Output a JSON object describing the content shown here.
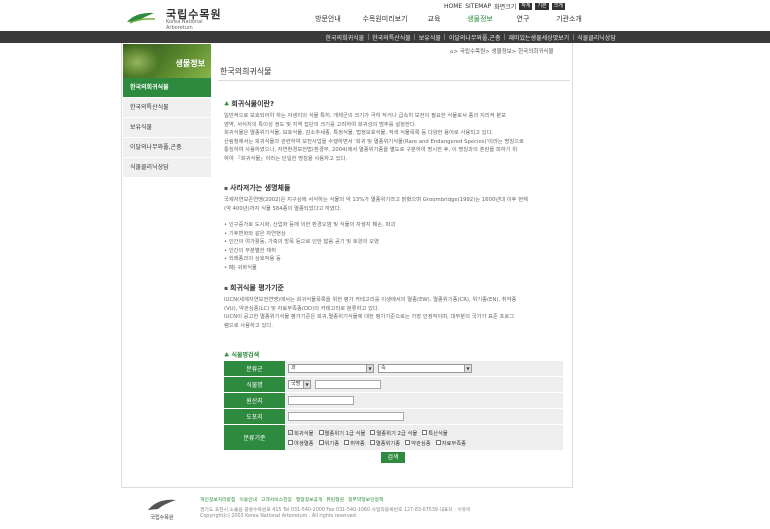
{
  "brand": {
    "name_ko": "국립수목원",
    "name_en": "Korea National Arboretum"
  },
  "util": {
    "home": "HOME",
    "sitemap": "SITEMAP",
    "font_size_label": "화면크기",
    "font_small": "작게",
    "font_normal": "기본",
    "font_large": "크게"
  },
  "gnb": [
    "방문안내",
    "수목원미리보기",
    "교육",
    "생물정보",
    "연구",
    "기관소개"
  ],
  "subnav": [
    "한국의희귀식물",
    "한국의특산식물",
    "보유식물",
    "이달의나무와풀,곤충",
    "재미있는생물세상엿보기",
    "식물클리닉상담"
  ],
  "side": {
    "title": "생물정보",
    "items": [
      "한국의희귀식물",
      "한국의특산식물",
      "보유식물",
      "이달의나무와풀,곤충",
      "식물클리닉상담"
    ]
  },
  "breadcrumb": "> 국립수목원> 생물정보> 한국의희귀식물",
  "page_title": "한국의희귀식물",
  "sections": {
    "s1_title": "희귀식물이란?",
    "s1_lines": [
      "일반적으로 보호되어야 하는 자생지의 식물 특히, 개체군의 크기가 극히 작거나 급속히 보전이 필요한 식물로서 종의 지리적 분포",
      "영역, 서식지의 특이성 정도 및 지역 집단의 크기를 고려하여 희귀성의 범주를 설정한다.",
      "희귀식물은 멸종위기식물, 보호식물, 감소추세종, 특정식물, 법정보호식물, 적색 식물목록 등 다양한 용어로 사용되고 있다.",
      "산림청에서는 희귀식물과 관련하여 보전사업을 수행하면서 '희귀 및 멸종위기식물(Rare and Endangered Species)'이라는 명칭으로",
      "통칭하여 사용하였으나, 자연환경보전법(환경부, 2004)에서 멸종위기종을 별도로 구분하여 명시한 후, 이 명칭과의 혼란을 피하기 위",
      "하여 「희귀식물」이라는 단일한 명칭을 사용하고 있다."
    ],
    "s2_title": "사라져가는 생명체들",
    "s2_lines": [
      "국제자연보존연맹(2002)은 지구상에 서식하는 식물의 약 13%가 멸종위기라고 밝혔으며 Groombridge(1992)는 1600년대 이후 현재",
      "(약 400년)까지 식물 584종이 멸종되었다고 하였다."
    ],
    "s2_bullets": [
      "인구증가로 도시화, 산업화 등에 의한 환경오염 및 식물의 자생지 훼손, 파괴",
      "기후변화와 같은 자연현상",
      "인간의 여가활동, 가축의 방목 등으로 인한 밟음 공기 및 토양의 오염",
      "인간의 무분별한 채취",
      "외래종과의 상호작용 등",
      "폐) 귀화식물"
    ],
    "s3_title": "희귀식물 평가기준",
    "s3_lines": [
      "IUCN(세계자연보전연맹)에서는 희귀식물목록을 위한 평가 카테고리를 이생에서의 멸종(EW), 멸종위기종(CR), 위기종(EN), 취약종",
      "(VU), 약관심종(LC) 및 자료부족종(DD)의 카테고리로 분류하고 있다.",
      "IUCN이 공고한 멸종위기식물 평가기준은 희귀,멸종위기식물에 대한 평가기준으로는 가장 안정적이며, 대부분의 국가가 표준 프로그",
      "램으로 사용하고 있다."
    ]
  },
  "search": {
    "title": "식물명검색",
    "labels": {
      "group": "분류군",
      "plant_name": "식물명",
      "habitat": "원산지",
      "protected": "도포지",
      "grade": "분류기준"
    },
    "group_value1": "과",
    "group_value2": "속",
    "name_select": "국명",
    "grade_row1": [
      "희귀식물",
      "멸종위기 1급 식물",
      "멸종위기 2급 식물",
      "특산식물"
    ],
    "grade_row2": [
      "야생멸종",
      "위기종",
      "취약종",
      "멸종위기종",
      "약관심종",
      "자료부족종"
    ],
    "button": "검색"
  },
  "footer": {
    "logo_text": "국립수목원",
    "links": [
      "개인정보처리방침",
      "이용안내",
      "고객서비스헌장",
      "행정정보공개",
      "뷰린형원",
      "정부약정보안정책"
    ],
    "address": "경기도 포천시 소흘읍 광릉수목원로 415 Tel 031-540-2000  Fax 031-540-1060  사업자등록번호 127-83-07539  대표자 : 이유미",
    "copyright": "Copyright(c) 2003 Korea National Arboretum . All rights reserved"
  }
}
